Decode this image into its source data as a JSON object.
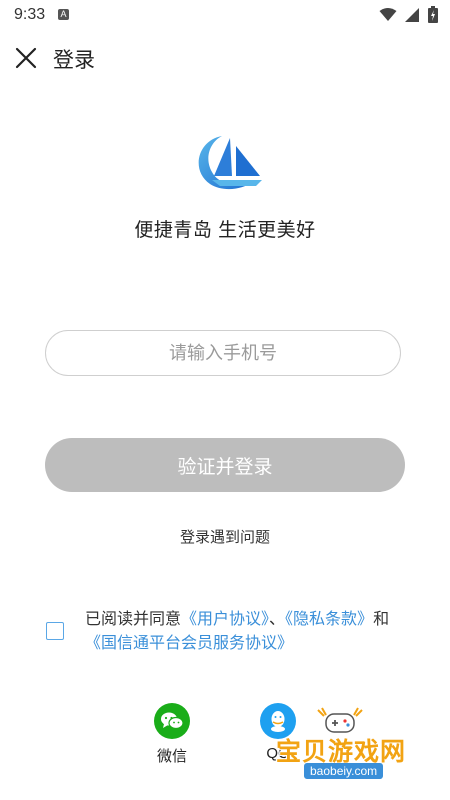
{
  "status_bar": {
    "time": "9:33",
    "left_icons": [
      "a-notification-icon"
    ],
    "right_icons": [
      "wifi-icon",
      "signal-icon",
      "battery-icon"
    ]
  },
  "header": {
    "title": "登录",
    "close_icon": "close-icon"
  },
  "brand": {
    "logo_icon": "sailboat-logo-icon",
    "slogan": "便捷青岛 生活更美好",
    "colors": {
      "logo_blue": "#1f6fd1",
      "logo_light_blue": "#58b6ea"
    }
  },
  "form": {
    "phone_placeholder": "请输入手机号",
    "phone_value": "",
    "login_button_label": "验证并登录",
    "login_problem_label": "登录遇到问题",
    "button_color": "#bdbdbd"
  },
  "agreement": {
    "checked": false,
    "prefix": "已阅读并同意",
    "user_agreement": "《用户协议》",
    "separator": "、",
    "privacy_terms": "《隐私条款》",
    "and": "和",
    "platform_agreement": "《国信通平台会员服务协议》",
    "link_color": "#3a8fd9"
  },
  "third_party_login": [
    {
      "label": "微信",
      "icon": "wechat-icon",
      "color": "#1aad19"
    },
    {
      "label": "QQ",
      "icon": "qq-icon",
      "color": "#1ea0f0"
    }
  ],
  "watermark": {
    "title": "宝贝游戏网",
    "url": "baobeiy.com",
    "icon": "gamepad-icon"
  }
}
